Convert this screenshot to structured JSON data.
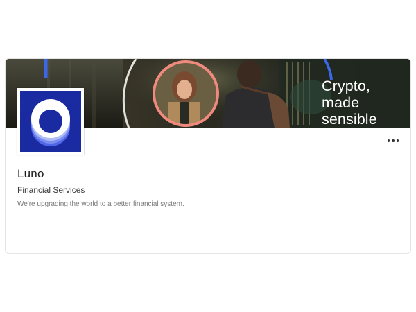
{
  "banner": {
    "tagline_lines": [
      "Crypto,",
      "made",
      "sensible"
    ]
  },
  "company": {
    "name": "Luno",
    "industry": "Financial Services",
    "description": "We're upgrading the world to a better financial system."
  },
  "icons": {
    "logo": "luno-ring-logo",
    "more": "more-horizontal-icon"
  },
  "colors": {
    "logo_background": "#1a2aa0",
    "banner_ring_pink": "#f08a7e",
    "banner_ring_blue": "#3a68e8"
  }
}
